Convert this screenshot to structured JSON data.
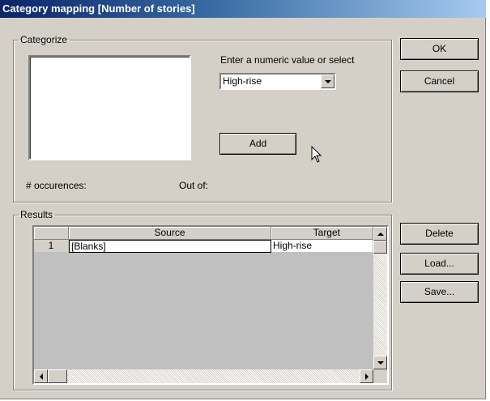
{
  "window": {
    "title": "Category mapping [Number of stories]"
  },
  "categorize": {
    "legend": "Categorize",
    "prompt": "Enter a numeric value or select",
    "select_value": "High-rise",
    "add_label": "Add",
    "occurrences_label": "# occurences:",
    "out_of_label": "Out of:"
  },
  "buttons": {
    "ok": "OK",
    "cancel": "Cancel",
    "delete": "Delete",
    "load": "Load...",
    "save": "Save..."
  },
  "results": {
    "legend": "Results",
    "columns": [
      "Source",
      "Target"
    ],
    "rows": [
      {
        "num": "1",
        "source": "[Blanks]",
        "target": "High-rise"
      }
    ]
  }
}
